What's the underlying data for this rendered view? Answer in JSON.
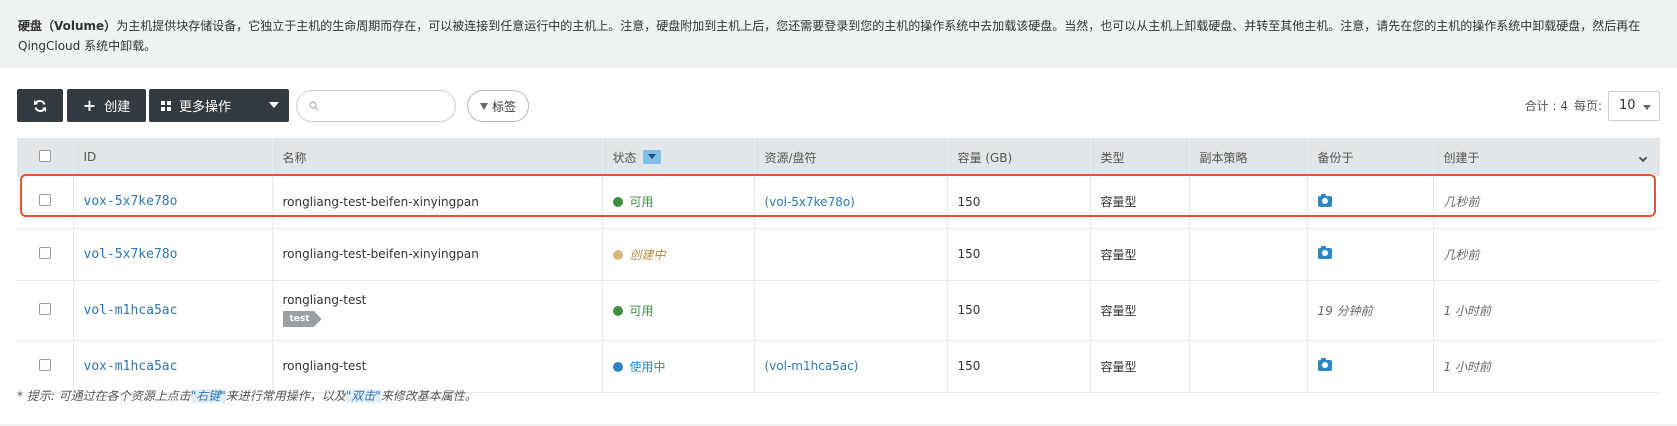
{
  "notice": {
    "bold": "硬盘（Volume）",
    "text": "为主机提供块存储设备，它独立于主机的生命周期而存在，可以被连接到任意运行中的主机上。注意，硬盘附加到主机上后，您还需要登录到您的主机的操作系统中去加载该硬盘。当然，也可以从主机上卸载硬盘、并转至其他主机。注意，请先在您的主机的操作系统中卸载硬盘，然后再在 QingCloud 系统中卸载。"
  },
  "toolbar": {
    "create_label": "创建",
    "more_label": "更多操作",
    "search_placeholder": "",
    "tag_label": "标签",
    "total_label": "合计 : 4",
    "per_page_label": "每页:",
    "per_page_value": "10"
  },
  "table": {
    "headers": [
      "ID",
      "名称",
      "状态",
      "资源/盘符",
      "容量 (GB)",
      "类型",
      "副本策略",
      "备份于",
      "创建于"
    ],
    "rows": [
      {
        "id": "vox-5x7ke78o",
        "name": "rongliang-test-beifen-xinyingpan",
        "status": "可用",
        "status_color": "#3f8f3f",
        "resource": "(vol-5x7ke78o)",
        "capacity": "150",
        "type": "容量型",
        "replica": "",
        "backup": "camera-icon",
        "created": "几秒前"
      },
      {
        "id": "vol-5x7ke78o",
        "name": "rongliang-test-beifen-xinyingpan",
        "status": "创建中",
        "status_color": "#d9b77a",
        "resource": "",
        "capacity": "150",
        "type": "容量型",
        "replica": "",
        "backup": "camera-icon",
        "created": "几秒前"
      },
      {
        "id": "vol-m1hca5ac",
        "name": "rongliang-test",
        "tag": "test",
        "status": "可用",
        "status_color": "#3f8f3f",
        "resource": "",
        "capacity": "150",
        "type": "容量型",
        "replica": "",
        "backup_text": "19 分钟前",
        "created": "1 小时前"
      },
      {
        "id": "vox-m1hca5ac",
        "name": "rongliang-test",
        "status": "使用中",
        "status_color": "#2e86c1",
        "resource": "(vol-m1hca5ac)",
        "capacity": "150",
        "type": "容量型",
        "replica": "",
        "backup": "camera-icon",
        "created": "1 小时前"
      }
    ]
  },
  "tip": {
    "prefix": "* 提示: 可通过在各个资源上点击",
    "right_click": "\"右键\"",
    "middle": "来进行常用操作，以及",
    "double_click": "\"双击\"",
    "suffix": "来修改基本属性。"
  }
}
